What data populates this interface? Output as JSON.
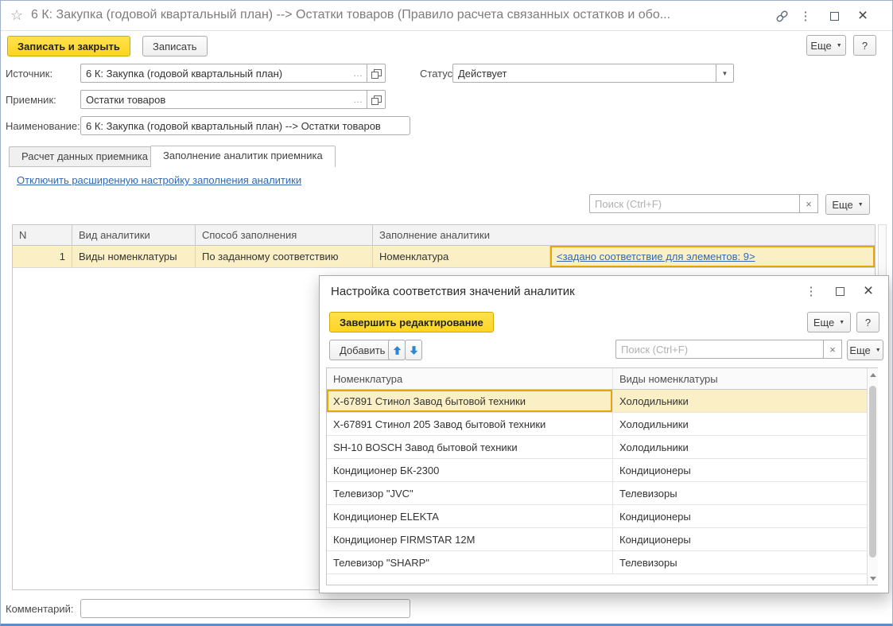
{
  "colors": {
    "accent_yellow": "#FFD92B",
    "selection_fill": "#FBF0C5",
    "selection_border": "#E7A600",
    "link_blue": "#3169B2"
  },
  "titlebar": {
    "title": "6 К: Закупка (годовой квартальный план) --> Остатки товаров (Правило расчета связанных остатков и обо..."
  },
  "toolbar": {
    "save_close_label": "Записать и закрыть",
    "save_label": "Записать",
    "more_label": "Еще",
    "help_label": "?"
  },
  "form": {
    "source": {
      "label": "Источник:",
      "value": "6 К: Закупка (годовой квартальный план)"
    },
    "status": {
      "label": "Статус:",
      "value": "Действует"
    },
    "receiver": {
      "label": "Приемник:",
      "value": "Остатки товаров"
    },
    "name": {
      "label": "Наименование:",
      "value": "6 К: Закупка (годовой квартальный план) --> Остатки товаров"
    },
    "comment": {
      "label": "Комментарий:",
      "value": ""
    }
  },
  "tabs": {
    "calc": "Расчет данных приемника",
    "fill": "Заполнение аналитик приемника"
  },
  "fill_tab": {
    "toggle_link": "Отключить расширенную настройку заполнения аналитики",
    "search_placeholder": "Поиск (Ctrl+F)",
    "clear_label": "×",
    "more_label": "Еще",
    "table": {
      "headers": {
        "num": "N",
        "kind": "Вид аналитики",
        "method": "Способ заполнения",
        "fill": "Заполнение аналитики"
      },
      "row": {
        "num": "1",
        "kind": "Виды номенклатуры",
        "method": "По заданному соответствию",
        "analytic": "Номенклатура",
        "mapping_link": "<задано соответствие для элементов: 9>"
      }
    }
  },
  "dialog": {
    "title": "Настройка соответствия значений аналитик",
    "finish_label": "Завершить редактирование",
    "add_label": "Добавить",
    "more_label": "Еще",
    "help_label": "?",
    "search_placeholder": "Поиск (Ctrl+F)",
    "clear_label": "×",
    "table": {
      "headers": {
        "name": "Номенклатура",
        "kind": "Виды номенклатуры"
      },
      "rows": [
        {
          "name": "Х-67891 Стинол Завод бытовой техники",
          "kind": "Холодильники"
        },
        {
          "name": "Х-67891 Стинол 205 Завод бытовой техники",
          "kind": "Холодильники"
        },
        {
          "name": "SH-10 BOSCH Завод бытовой техники",
          "kind": "Холодильники"
        },
        {
          "name": "Кондиционер БК-2300",
          "kind": "Кондиционеры"
        },
        {
          "name": "Телевизор \"JVC\"",
          "kind": "Телевизоры"
        },
        {
          "name": "Кондиционер ELEKTA",
          "kind": "Кондиционеры"
        },
        {
          "name": "Кондиционер FIRMSTAR 12M",
          "kind": "Кондиционеры"
        },
        {
          "name": "Телевизор \"SHARP\"",
          "kind": "Телевизоры"
        }
      ]
    }
  }
}
